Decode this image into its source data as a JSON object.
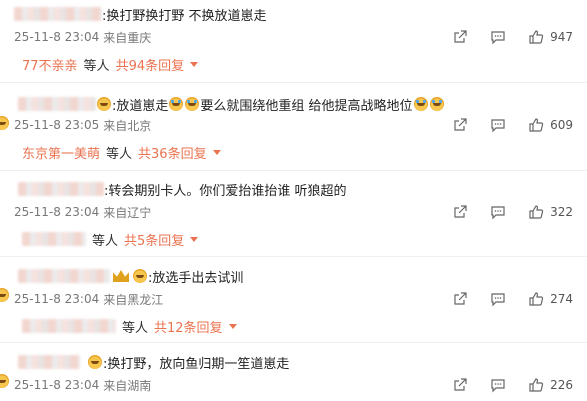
{
  "comments": [
    {
      "text": ":换打野换打野 不换放道崽走",
      "date": "25-11-8 23:04",
      "location": "来自重庆",
      "likes": "947",
      "replies": {
        "user": "77不亲亲",
        "deng": "等人",
        "count": "共94条回复"
      }
    },
    {
      "text_a": ":放道崽走",
      "text_b": "要么就围绕他重组 给他提高战略地位",
      "date": "25-11-8 23:05",
      "location": "来自北京",
      "likes": "609",
      "replies": {
        "user": "东京第一美萌",
        "deng": "等人",
        "count": "共36条回复"
      }
    },
    {
      "text": ":转会期别卡人。你们爱抬谁抬谁 听狼超的",
      "date": "25-11-8 23:04",
      "location": "来自辽宁",
      "likes": "322",
      "replies": {
        "deng": "等人",
        "count": "共5条回复"
      }
    },
    {
      "text": ":放选手出去试训",
      "date": "25-11-8 23:04",
      "location": "来自黑龙江",
      "likes": "274",
      "replies": {
        "deng": "等人",
        "count": "共12条回复"
      }
    },
    {
      "text": ":换打野，放向鱼归期一笙道崽走",
      "date": "25-11-8 23:04",
      "location": "来自湖南",
      "likes": "226"
    }
  ],
  "icons": {
    "share": "share-icon",
    "comment": "comment-icon",
    "like": "thumbs-up-icon",
    "reply_caret": "chevron-down-icon"
  },
  "colors": {
    "accent": "#eb7350",
    "meta": "#777777",
    "text": "#222222"
  }
}
